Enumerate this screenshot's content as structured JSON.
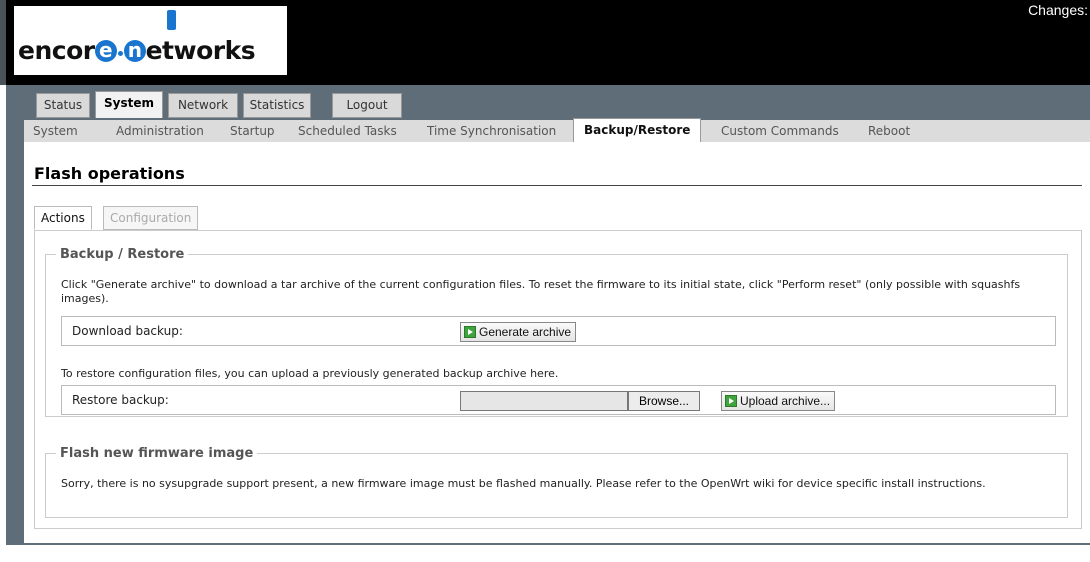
{
  "header": {
    "logo_text_before": "encor",
    "logo_e": "e",
    "logo_n": "n",
    "logo_text_after": "etworks",
    "changes": "Changes:"
  },
  "main_tabs": [
    {
      "label": "Status",
      "active": false
    },
    {
      "label": "System",
      "active": true
    },
    {
      "label": "Network",
      "active": false
    },
    {
      "label": "Statistics",
      "active": false
    },
    {
      "label": "Logout",
      "active": false
    }
  ],
  "sub_tabs": [
    {
      "label": "System"
    },
    {
      "label": "Administration"
    },
    {
      "label": "Startup"
    },
    {
      "label": "Scheduled Tasks"
    },
    {
      "label": "Time Synchronisation"
    },
    {
      "label": "Backup/Restore",
      "active": true
    },
    {
      "label": "Custom Commands"
    },
    {
      "label": "Reboot"
    }
  ],
  "page": {
    "title": "Flash operations",
    "tabs": [
      {
        "label": "Actions",
        "active": true
      },
      {
        "label": "Configuration",
        "active": false
      }
    ]
  },
  "backup": {
    "legend": "Backup / Restore",
    "description": "Click \"Generate archive\" to download a tar archive of the current configuration files. To reset the firmware to its initial state, click \"Perform reset\" (only possible with squashfs images).",
    "download_label": "Download backup:",
    "generate_button": "Generate archive",
    "restore_hint": "To restore configuration files, you can upload a previously generated backup archive here.",
    "restore_label": "Restore backup:",
    "browse_button": "Browse...",
    "upload_button": "Upload archive...",
    "file_value": ""
  },
  "firmware": {
    "legend": "Flash new firmware image",
    "description": "Sorry, there is no sysupgrade support present, a new firmware image must be flashed manually. Please refer to the OpenWrt wiki for device specific install instructions."
  },
  "colors": {
    "header_bg": "#000000",
    "frame_bg": "#5e6d77",
    "logo_accent": "#1a75cf",
    "button_icon": "#3fa33f"
  }
}
